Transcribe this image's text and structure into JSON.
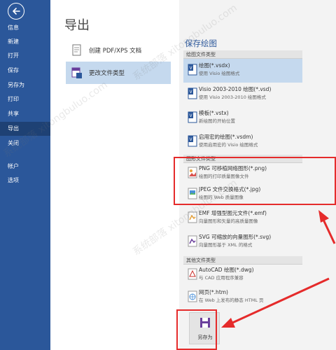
{
  "sidebar": {
    "items": [
      {
        "label": "信息"
      },
      {
        "label": "新建"
      },
      {
        "label": "打开"
      },
      {
        "label": "保存"
      },
      {
        "label": "另存为"
      },
      {
        "label": "打印"
      },
      {
        "label": "共享"
      },
      {
        "label": "导出"
      },
      {
        "label": "关闭"
      },
      {
        "label": "帐户"
      },
      {
        "label": "选项"
      }
    ]
  },
  "page": {
    "title": "导出"
  },
  "export_options": [
    {
      "label": "创建 PDF/XPS 文档"
    },
    {
      "label": "更改文件类型"
    }
  ],
  "right_panel": {
    "title": "保存绘图",
    "sections": [
      {
        "header": "绘图文件类型"
      },
      {
        "header": "图形文件类型"
      },
      {
        "header": "其他文件类型"
      }
    ],
    "file_types": [
      {
        "name": "绘图(*.vsdx)",
        "desc": "使用 Visio 绘图格式"
      },
      {
        "name": "Visio 2003-2010 绘图(*.vsd)",
        "desc": "使用 Visio 2003-2010 绘图格式"
      },
      {
        "name": "模板(*.vstx)",
        "desc": "新绘图的开始位置"
      },
      {
        "name": "启用宏的绘图(*.vsdm)",
        "desc": "使用启用宏的 Visio 绘图格式"
      },
      {
        "name": "PNG 可移植网络图形(*.png)",
        "desc": "绘图的打印质量图像文件"
      },
      {
        "name": "JPEG 文件交换格式(*.jpg)",
        "desc": "绘图的 Web 质量图像"
      },
      {
        "name": "EMF 增强型图元文件(*.emf)",
        "desc": "向量图形和矢量的高质量图像"
      },
      {
        "name": "SVG 可缩放的向量图形(*.svg)",
        "desc": "向量图形基于 XML 的格式"
      },
      {
        "name": "AutoCAD 绘图(*.dwg)",
        "desc": "与 CAD 应用程序兼容"
      },
      {
        "name": "网页(*.htm)",
        "desc": "在 Web 上发布的静态 HTML 页"
      }
    ],
    "save_as_button": {
      "label": "另存为"
    }
  },
  "watermark": {
    "text": "系统部落 xitongbuluo.com"
  },
  "colors": {
    "sidebar": "#2b579a",
    "accent": "#2b579a",
    "selection": "#c5d9ee",
    "annotation": "#e52b2b"
  }
}
